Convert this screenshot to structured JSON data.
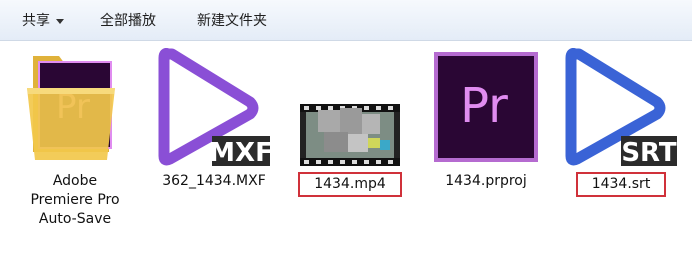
{
  "toolbar": {
    "share_label": "共享",
    "play_all_label": "全部播放",
    "new_folder_label": "新建文件夹"
  },
  "files": [
    {
      "name_lines": [
        "Adobe",
        "Premiere Pro",
        "Auto-Save"
      ],
      "icon": "folder-icon",
      "overlay": "Pr"
    },
    {
      "name": "362_1434.MXF",
      "icon": "play-icon",
      "badge": "MXF"
    },
    {
      "name": "1434.mp4",
      "icon": "video-thumbnail-icon",
      "highlighted": true
    },
    {
      "name": "1434.prproj",
      "icon": "premiere-project-icon",
      "overlay": "Pr"
    },
    {
      "name": "1434.srt",
      "icon": "play-icon",
      "badge": "SRT",
      "highlighted": true
    }
  ],
  "colors": {
    "highlight": "#d0313a",
    "play_purple": "#8a4fd6",
    "play_blue": "#3a63d6",
    "premiere_bg": "#2a0634",
    "premiere_text": "#e08cf0",
    "folder": "#f2c84b"
  }
}
